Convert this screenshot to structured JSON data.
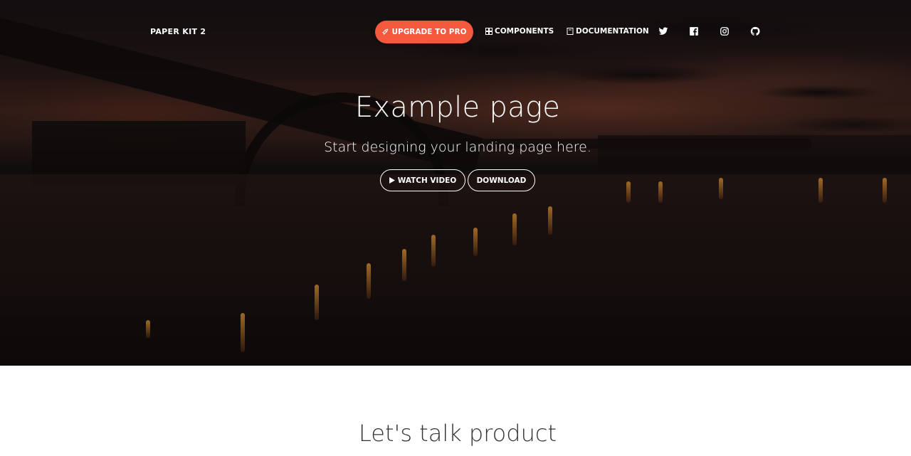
{
  "navbar": {
    "brand": "PAPER KIT 2",
    "upgrade_label": "UPGRADE TO PRO",
    "components_label": "COMPONENTS",
    "documentation_label": "DOCUMENTATION",
    "social_icons": [
      "twitter-icon",
      "facebook-icon",
      "instagram-icon",
      "github-icon"
    ]
  },
  "hero": {
    "title": "Example page",
    "subtitle": "Start designing your landing page here.",
    "watch_video_label": "WATCH VIDEO",
    "download_label": "DOWNLOAD"
  },
  "section": {
    "title": "Let's talk product"
  },
  "colors": {
    "accent": "#f5593d",
    "text_dark": "#333333",
    "white": "#ffffff"
  }
}
